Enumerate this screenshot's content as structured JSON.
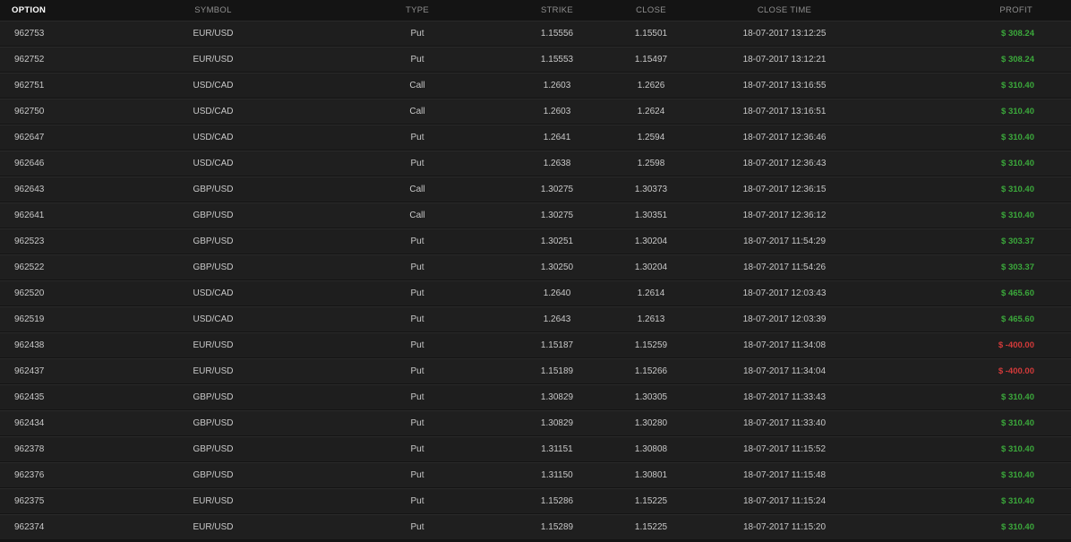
{
  "columns": {
    "option": "OPTION",
    "symbol": "SYMBOL",
    "type": "TYPE",
    "strike": "STRIKE",
    "close": "CLOSE",
    "close_time": "CLOSE TIME",
    "profit": "PROFIT"
  },
  "colors": {
    "profit_positive": "#3ba83b",
    "profit_negative": "#d23a3a",
    "background": "#141414",
    "row_background": "#1f1f1f"
  },
  "rows": [
    {
      "option": "962753",
      "symbol": "EUR/USD",
      "type": "Put",
      "strike": "1.15556",
      "close": "1.15501",
      "close_time": "18-07-2017 13:12:25",
      "profit": "$ 308.24",
      "profit_sign": "pos"
    },
    {
      "option": "962752",
      "symbol": "EUR/USD",
      "type": "Put",
      "strike": "1.15553",
      "close": "1.15497",
      "close_time": "18-07-2017 13:12:21",
      "profit": "$ 308.24",
      "profit_sign": "pos"
    },
    {
      "option": "962751",
      "symbol": "USD/CAD",
      "type": "Call",
      "strike": "1.2603",
      "close": "1.2626",
      "close_time": "18-07-2017 13:16:55",
      "profit": "$ 310.40",
      "profit_sign": "pos"
    },
    {
      "option": "962750",
      "symbol": "USD/CAD",
      "type": "Call",
      "strike": "1.2603",
      "close": "1.2624",
      "close_time": "18-07-2017 13:16:51",
      "profit": "$ 310.40",
      "profit_sign": "pos"
    },
    {
      "option": "962647",
      "symbol": "USD/CAD",
      "type": "Put",
      "strike": "1.2641",
      "close": "1.2594",
      "close_time": "18-07-2017 12:36:46",
      "profit": "$ 310.40",
      "profit_sign": "pos"
    },
    {
      "option": "962646",
      "symbol": "USD/CAD",
      "type": "Put",
      "strike": "1.2638",
      "close": "1.2598",
      "close_time": "18-07-2017 12:36:43",
      "profit": "$ 310.40",
      "profit_sign": "pos"
    },
    {
      "option": "962643",
      "symbol": "GBP/USD",
      "type": "Call",
      "strike": "1.30275",
      "close": "1.30373",
      "close_time": "18-07-2017 12:36:15",
      "profit": "$ 310.40",
      "profit_sign": "pos"
    },
    {
      "option": "962641",
      "symbol": "GBP/USD",
      "type": "Call",
      "strike": "1.30275",
      "close": "1.30351",
      "close_time": "18-07-2017 12:36:12",
      "profit": "$ 310.40",
      "profit_sign": "pos"
    },
    {
      "option": "962523",
      "symbol": "GBP/USD",
      "type": "Put",
      "strike": "1.30251",
      "close": "1.30204",
      "close_time": "18-07-2017 11:54:29",
      "profit": "$ 303.37",
      "profit_sign": "pos"
    },
    {
      "option": "962522",
      "symbol": "GBP/USD",
      "type": "Put",
      "strike": "1.30250",
      "close": "1.30204",
      "close_time": "18-07-2017 11:54:26",
      "profit": "$ 303.37",
      "profit_sign": "pos"
    },
    {
      "option": "962520",
      "symbol": "USD/CAD",
      "type": "Put",
      "strike": "1.2640",
      "close": "1.2614",
      "close_time": "18-07-2017 12:03:43",
      "profit": "$ 465.60",
      "profit_sign": "pos"
    },
    {
      "option": "962519",
      "symbol": "USD/CAD",
      "type": "Put",
      "strike": "1.2643",
      "close": "1.2613",
      "close_time": "18-07-2017 12:03:39",
      "profit": "$ 465.60",
      "profit_sign": "pos"
    },
    {
      "option": "962438",
      "symbol": "EUR/USD",
      "type": "Put",
      "strike": "1.15187",
      "close": "1.15259",
      "close_time": "18-07-2017 11:34:08",
      "profit": "$ -400.00",
      "profit_sign": "neg"
    },
    {
      "option": "962437",
      "symbol": "EUR/USD",
      "type": "Put",
      "strike": "1.15189",
      "close": "1.15266",
      "close_time": "18-07-2017 11:34:04",
      "profit": "$ -400.00",
      "profit_sign": "neg"
    },
    {
      "option": "962435",
      "symbol": "GBP/USD",
      "type": "Put",
      "strike": "1.30829",
      "close": "1.30305",
      "close_time": "18-07-2017 11:33:43",
      "profit": "$ 310.40",
      "profit_sign": "pos"
    },
    {
      "option": "962434",
      "symbol": "GBP/USD",
      "type": "Put",
      "strike": "1.30829",
      "close": "1.30280",
      "close_time": "18-07-2017 11:33:40",
      "profit": "$ 310.40",
      "profit_sign": "pos"
    },
    {
      "option": "962378",
      "symbol": "GBP/USD",
      "type": "Put",
      "strike": "1.31151",
      "close": "1.30808",
      "close_time": "18-07-2017 11:15:52",
      "profit": "$ 310.40",
      "profit_sign": "pos"
    },
    {
      "option": "962376",
      "symbol": "GBP/USD",
      "type": "Put",
      "strike": "1.31150",
      "close": "1.30801",
      "close_time": "18-07-2017 11:15:48",
      "profit": "$ 310.40",
      "profit_sign": "pos"
    },
    {
      "option": "962375",
      "symbol": "EUR/USD",
      "type": "Put",
      "strike": "1.15286",
      "close": "1.15225",
      "close_time": "18-07-2017 11:15:24",
      "profit": "$ 310.40",
      "profit_sign": "pos"
    },
    {
      "option": "962374",
      "symbol": "EUR/USD",
      "type": "Put",
      "strike": "1.15289",
      "close": "1.15225",
      "close_time": "18-07-2017 11:15:20",
      "profit": "$ 310.40",
      "profit_sign": "pos"
    }
  ]
}
